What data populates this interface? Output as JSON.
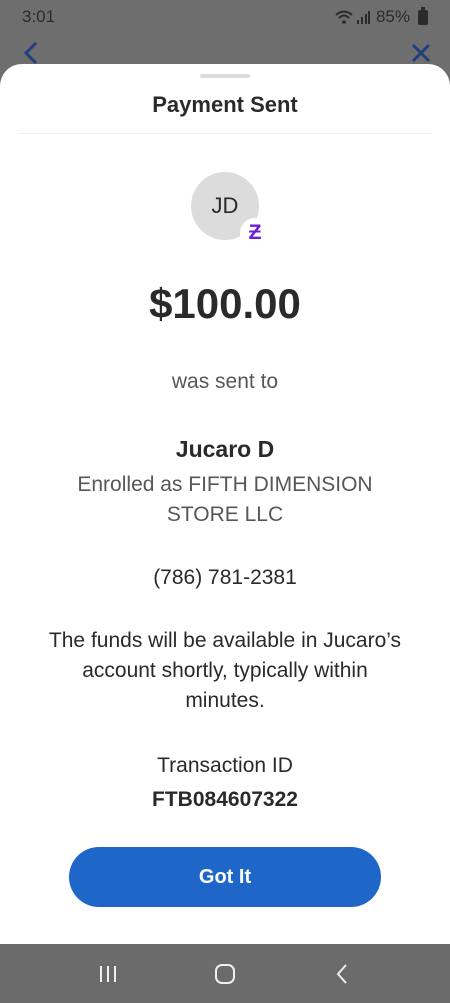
{
  "status_bar": {
    "time": "3:01",
    "battery": "85%",
    "icons": [
      "wifi-icon",
      "signal-icon",
      "battery-icon"
    ]
  },
  "behind_nav": {
    "back_icon": "chevron-left-icon",
    "close_icon": "close-icon"
  },
  "sheet": {
    "title": "Payment Sent",
    "avatar_initials": "JD",
    "badge_icon": "zelle-icon",
    "badge_glyph": "Ƶ",
    "amount": "$100.00",
    "sent_to_text": "was sent to",
    "recipient_name": "Jucaro D",
    "enrolled_text": "Enrolled as FIFTH DIMENSION STORE LLC",
    "phone": "(786) 781-2381",
    "funds_note": "The funds will be available in Jucaro’s account shortly, typically within minutes.",
    "transaction_label": "Transaction ID",
    "transaction_id": "FTB084607322",
    "button_label": "Got It"
  },
  "colors": {
    "accent": "#1f66c9",
    "zelle_purple": "#6d1ed4",
    "overlay": "#6e6e6e"
  }
}
